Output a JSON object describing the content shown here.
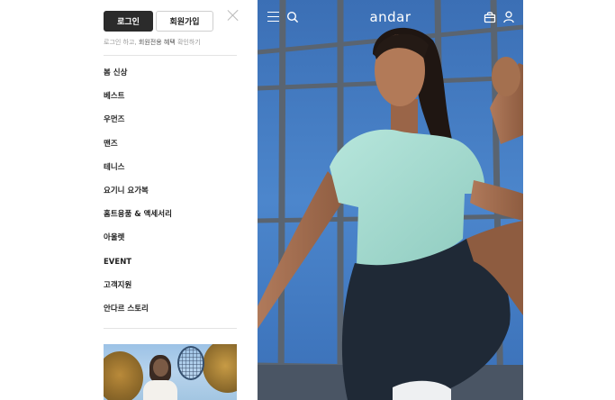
{
  "drawer": {
    "login_label": "로그인",
    "signup_label": "회원가입",
    "hint_prefix": "로그인 하고, ",
    "hint_highlight": "회원전용 혜택",
    "hint_suffix": " 확인하기",
    "menu": [
      {
        "label": "봄 신상"
      },
      {
        "label": "베스트"
      },
      {
        "label": "우먼즈"
      },
      {
        "label": "맨즈"
      },
      {
        "label": "테니스"
      },
      {
        "label": "요기니 요가복"
      },
      {
        "label": "홈트용품 & 액세서리"
      },
      {
        "label": "아울렛"
      },
      {
        "label": "EVENT"
      },
      {
        "label": "고객지원"
      },
      {
        "label": "안다르 스토리"
      }
    ]
  },
  "header": {
    "brand": "andar",
    "icons": [
      "menu-icon",
      "search-icon",
      "bag-icon",
      "user-icon"
    ]
  },
  "colors": {
    "accent_dark": "#2b2b2b",
    "sky": "#3f79c2",
    "shirt": "#a7ddd3",
    "shorts": "#1f2936"
  }
}
